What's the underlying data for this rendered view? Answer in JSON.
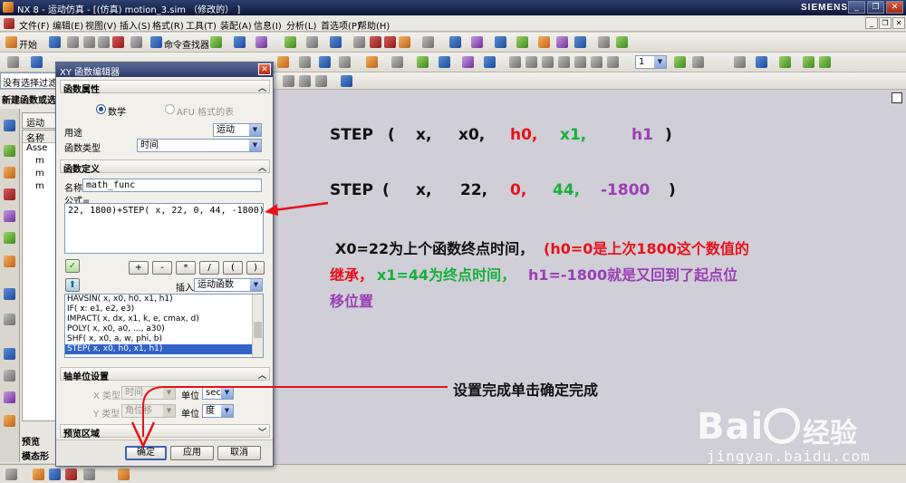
{
  "window": {
    "title": "NX 8 - 运动仿真 - [(仿真) motion_3.sim （修改的） ]",
    "brand": "SIEMENS"
  },
  "menu": [
    "文件(F)",
    "编辑(E)",
    "视图(V)",
    "插入(S)",
    "格式(R)",
    "工具(T)",
    "装配(A)",
    "信息(I)",
    "分析(L)",
    "首选项(P)",
    "帮助(H)"
  ],
  "toolbar": {
    "start_label": "开始",
    "command_finder_label": "命令查找器",
    "combo_value": "1"
  },
  "selection": {
    "filter_text": "没有选择过滤"
  },
  "left_panel": {
    "new_function_label": "新建函数或选",
    "nav_tab": "运动",
    "tree_header": "名称",
    "tree_items": [
      "Asse",
      "m",
      "m",
      "m"
    ],
    "preview_label": "预览",
    "mode_shape_label": "模态形"
  },
  "dialog": {
    "title": "XY 函数编辑器",
    "function_props_header": "函数属性",
    "radio_math": "数学",
    "radio_afu": "AFU 格式的表",
    "usage_label": "用途",
    "usage_value": "运动",
    "func_type_label": "函数类型",
    "func_type_value": "时间",
    "func_def_header": "函数定义",
    "name_label": "名称",
    "name_value": "math_func",
    "formula_label": "公式=",
    "formula_value": "22, 1800)+STEP( x, 22, 0, 44, -1800)",
    "op_buttons": [
      "+",
      "-",
      "*",
      "/",
      "(",
      ")"
    ],
    "insert_label": "插入",
    "insert_value": "运动函数",
    "function_list": [
      "HAVSIN( x, x0, h0, x1, h1)",
      "IF( x: e1, e2, e3)",
      "IMPACT( x, dx, x1, k, e, cmax, d)",
      "POLY( x, x0, a0, ..., a30)",
      "SHF( x, x0, a, w, phi, b)",
      "STEP( x, x0, h0, x1, h1)"
    ],
    "selected_function_index": 5,
    "axis_units_header": "轴单位设置",
    "x_type_label": "X 类型",
    "x_type_value": "时间",
    "x_unit_label": "单位",
    "x_unit_value": "sec",
    "y_type_label": "Y 类型",
    "y_type_value": "角位移",
    "y_unit_label": "单位",
    "y_unit_value": "度",
    "preview_header": "预览区域",
    "ok_label": "确定",
    "apply_label": "应用",
    "cancel_label": "取消"
  },
  "annotations": {
    "step_tokens": [
      "STEP",
      "(",
      "x,",
      "x0,",
      "h0,",
      "x1,",
      "h1",
      ")"
    ],
    "step_values": [
      "STEP",
      "(",
      "x,",
      "22,",
      "0,",
      "44,",
      "-1800",
      ")"
    ],
    "explain_black": "X0=22为上个函数终点时间，",
    "explain_red_1": "(h0=0是上次1800这个数值的",
    "explain_red_2": "继承，",
    "explain_green": "x1=44为终点时间，",
    "explain_purple_1": "h1=-1800就是又回到了起点位",
    "explain_purple_2": "移位置",
    "confirm_note": "设置完成单击确定完成",
    "colors": {
      "red": "#e8121a",
      "green": "#17b03c",
      "purple": "#9a3fb6",
      "black": "#111111"
    }
  },
  "watermark": {
    "brand": "Bai",
    "brand_cn": "经验",
    "url": "jingyan.baidu.com"
  }
}
